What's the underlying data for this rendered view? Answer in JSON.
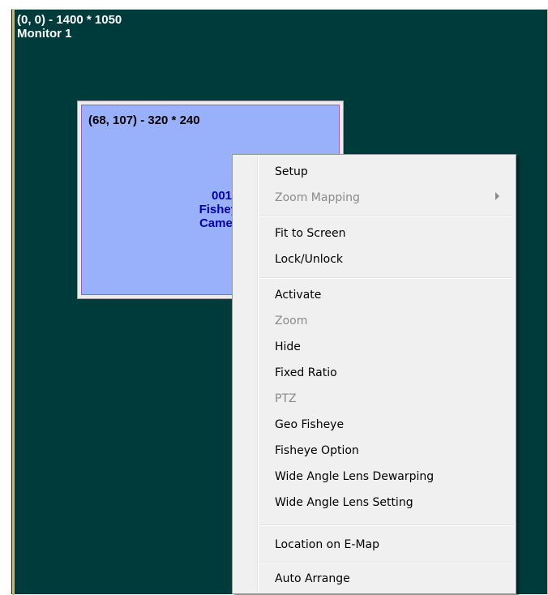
{
  "monitor": {
    "coords": "(0, 0) - 1400 * 1050",
    "name": "Monitor 1"
  },
  "camera": {
    "coords": "(68, 107) - 320 * 240",
    "number": "001",
    "line2": "Fisheye",
    "line3": "Camera"
  },
  "menu": {
    "setup": "Setup",
    "zoom_mapping": "Zoom Mapping",
    "fit_to_screen": "Fit to Screen",
    "lock_unlock": "Lock/Unlock",
    "activate": "Activate",
    "zoom": "Zoom",
    "hide": "Hide",
    "fixed_ratio": "Fixed Ratio",
    "ptz": "PTZ",
    "geo_fisheye": "Geo Fisheye",
    "fisheye_option": "Fisheye Option",
    "wide_angle_dewarping": "Wide Angle Lens Dewarping",
    "wide_angle_setting": "Wide Angle Lens Setting",
    "location_emap": "Location on E-Map",
    "auto_arrange": "Auto Arrange"
  }
}
